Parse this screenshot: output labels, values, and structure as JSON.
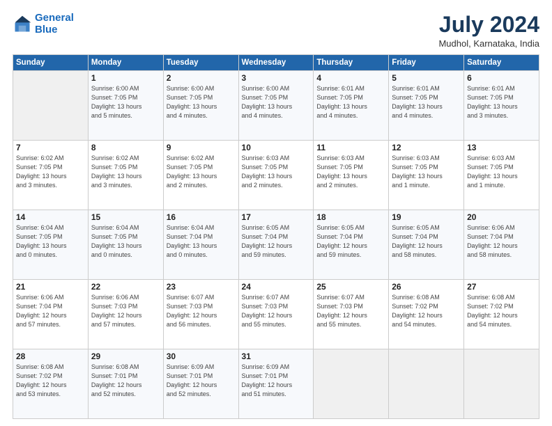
{
  "header": {
    "logo_line1": "General",
    "logo_line2": "Blue",
    "month_year": "July 2024",
    "location": "Mudhol, Karnataka, India"
  },
  "days_of_week": [
    "Sunday",
    "Monday",
    "Tuesday",
    "Wednesday",
    "Thursday",
    "Friday",
    "Saturday"
  ],
  "weeks": [
    [
      {
        "day": "",
        "info": ""
      },
      {
        "day": "1",
        "info": "Sunrise: 6:00 AM\nSunset: 7:05 PM\nDaylight: 13 hours\nand 5 minutes."
      },
      {
        "day": "2",
        "info": "Sunrise: 6:00 AM\nSunset: 7:05 PM\nDaylight: 13 hours\nand 4 minutes."
      },
      {
        "day": "3",
        "info": "Sunrise: 6:00 AM\nSunset: 7:05 PM\nDaylight: 13 hours\nand 4 minutes."
      },
      {
        "day": "4",
        "info": "Sunrise: 6:01 AM\nSunset: 7:05 PM\nDaylight: 13 hours\nand 4 minutes."
      },
      {
        "day": "5",
        "info": "Sunrise: 6:01 AM\nSunset: 7:05 PM\nDaylight: 13 hours\nand 4 minutes."
      },
      {
        "day": "6",
        "info": "Sunrise: 6:01 AM\nSunset: 7:05 PM\nDaylight: 13 hours\nand 3 minutes."
      }
    ],
    [
      {
        "day": "7",
        "info": "Sunrise: 6:02 AM\nSunset: 7:05 PM\nDaylight: 13 hours\nand 3 minutes."
      },
      {
        "day": "8",
        "info": "Sunrise: 6:02 AM\nSunset: 7:05 PM\nDaylight: 13 hours\nand 3 minutes."
      },
      {
        "day": "9",
        "info": "Sunrise: 6:02 AM\nSunset: 7:05 PM\nDaylight: 13 hours\nand 2 minutes."
      },
      {
        "day": "10",
        "info": "Sunrise: 6:03 AM\nSunset: 7:05 PM\nDaylight: 13 hours\nand 2 minutes."
      },
      {
        "day": "11",
        "info": "Sunrise: 6:03 AM\nSunset: 7:05 PM\nDaylight: 13 hours\nand 2 minutes."
      },
      {
        "day": "12",
        "info": "Sunrise: 6:03 AM\nSunset: 7:05 PM\nDaylight: 13 hours\nand 1 minute."
      },
      {
        "day": "13",
        "info": "Sunrise: 6:03 AM\nSunset: 7:05 PM\nDaylight: 13 hours\nand 1 minute."
      }
    ],
    [
      {
        "day": "14",
        "info": "Sunrise: 6:04 AM\nSunset: 7:05 PM\nDaylight: 13 hours\nand 0 minutes."
      },
      {
        "day": "15",
        "info": "Sunrise: 6:04 AM\nSunset: 7:05 PM\nDaylight: 13 hours\nand 0 minutes."
      },
      {
        "day": "16",
        "info": "Sunrise: 6:04 AM\nSunset: 7:04 PM\nDaylight: 13 hours\nand 0 minutes."
      },
      {
        "day": "17",
        "info": "Sunrise: 6:05 AM\nSunset: 7:04 PM\nDaylight: 12 hours\nand 59 minutes."
      },
      {
        "day": "18",
        "info": "Sunrise: 6:05 AM\nSunset: 7:04 PM\nDaylight: 12 hours\nand 59 minutes."
      },
      {
        "day": "19",
        "info": "Sunrise: 6:05 AM\nSunset: 7:04 PM\nDaylight: 12 hours\nand 58 minutes."
      },
      {
        "day": "20",
        "info": "Sunrise: 6:06 AM\nSunset: 7:04 PM\nDaylight: 12 hours\nand 58 minutes."
      }
    ],
    [
      {
        "day": "21",
        "info": "Sunrise: 6:06 AM\nSunset: 7:04 PM\nDaylight: 12 hours\nand 57 minutes."
      },
      {
        "day": "22",
        "info": "Sunrise: 6:06 AM\nSunset: 7:03 PM\nDaylight: 12 hours\nand 57 minutes."
      },
      {
        "day": "23",
        "info": "Sunrise: 6:07 AM\nSunset: 7:03 PM\nDaylight: 12 hours\nand 56 minutes."
      },
      {
        "day": "24",
        "info": "Sunrise: 6:07 AM\nSunset: 7:03 PM\nDaylight: 12 hours\nand 55 minutes."
      },
      {
        "day": "25",
        "info": "Sunrise: 6:07 AM\nSunset: 7:03 PM\nDaylight: 12 hours\nand 55 minutes."
      },
      {
        "day": "26",
        "info": "Sunrise: 6:08 AM\nSunset: 7:02 PM\nDaylight: 12 hours\nand 54 minutes."
      },
      {
        "day": "27",
        "info": "Sunrise: 6:08 AM\nSunset: 7:02 PM\nDaylight: 12 hours\nand 54 minutes."
      }
    ],
    [
      {
        "day": "28",
        "info": "Sunrise: 6:08 AM\nSunset: 7:02 PM\nDaylight: 12 hours\nand 53 minutes."
      },
      {
        "day": "29",
        "info": "Sunrise: 6:08 AM\nSunset: 7:01 PM\nDaylight: 12 hours\nand 52 minutes."
      },
      {
        "day": "30",
        "info": "Sunrise: 6:09 AM\nSunset: 7:01 PM\nDaylight: 12 hours\nand 52 minutes."
      },
      {
        "day": "31",
        "info": "Sunrise: 6:09 AM\nSunset: 7:01 PM\nDaylight: 12 hours\nand 51 minutes."
      },
      {
        "day": "",
        "info": ""
      },
      {
        "day": "",
        "info": ""
      },
      {
        "day": "",
        "info": ""
      }
    ]
  ]
}
